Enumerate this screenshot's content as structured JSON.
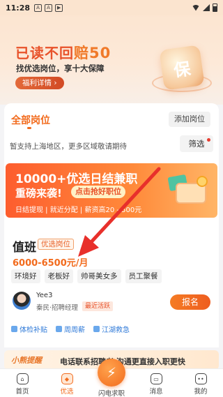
{
  "status_bar": {
    "time": "11:28",
    "icons": [
      "a-icon",
      "a-icon",
      "play-icon"
    ],
    "right_icons": [
      "wifi-icon",
      "signal-icon",
      "battery-icon"
    ]
  },
  "hero": {
    "title_main": "已读不回",
    "title_highlight": "赔50",
    "subtitle": "找优选岗位，享十大保障",
    "button_label": "福利详情 ›",
    "shield_char": "保"
  },
  "tabs": {
    "active_label": "全部岗位",
    "add_label": "添加岗位"
  },
  "notice": {
    "text": "暂支持上海地区，更多区域敬请期待",
    "filter_label": "筛选"
  },
  "promo": {
    "title": "10000+优选日结兼职",
    "line2": "重磅来袭!",
    "cta": "点击抢好职位",
    "sub": "日结提现 | 就近分配 | 薪资高20 - 500元"
  },
  "job": {
    "title": "值班",
    "tag": "优选岗位",
    "salary": "6000-6500元/月",
    "perks": [
      "环境好",
      "老板好",
      "帅哥美女多",
      "员工聚餐"
    ],
    "recruiter_name": "Yee3",
    "recruiter_role": "秦民·招聘经理",
    "active_badge": "最近活跃",
    "apply_label": "报名",
    "benefits": [
      "体检补贴",
      "周周薪",
      "江湖救急"
    ]
  },
  "tip": {
    "badge": "小熊提醒",
    "text": "电话联系招聘者 沟通更直接入职更快"
  },
  "bottom_nav": {
    "items": [
      {
        "label": "首页",
        "icon": "home-icon"
      },
      {
        "label": "优选",
        "icon": "diamond-icon"
      },
      {
        "label": "消息",
        "icon": "message-icon"
      },
      {
        "label": "我的",
        "icon": "profile-icon"
      }
    ],
    "center_label": "闪电求职",
    "active_index": 1
  },
  "colors": {
    "accent": "#f26b1d",
    "annotation_arrow": "#e8302b"
  }
}
